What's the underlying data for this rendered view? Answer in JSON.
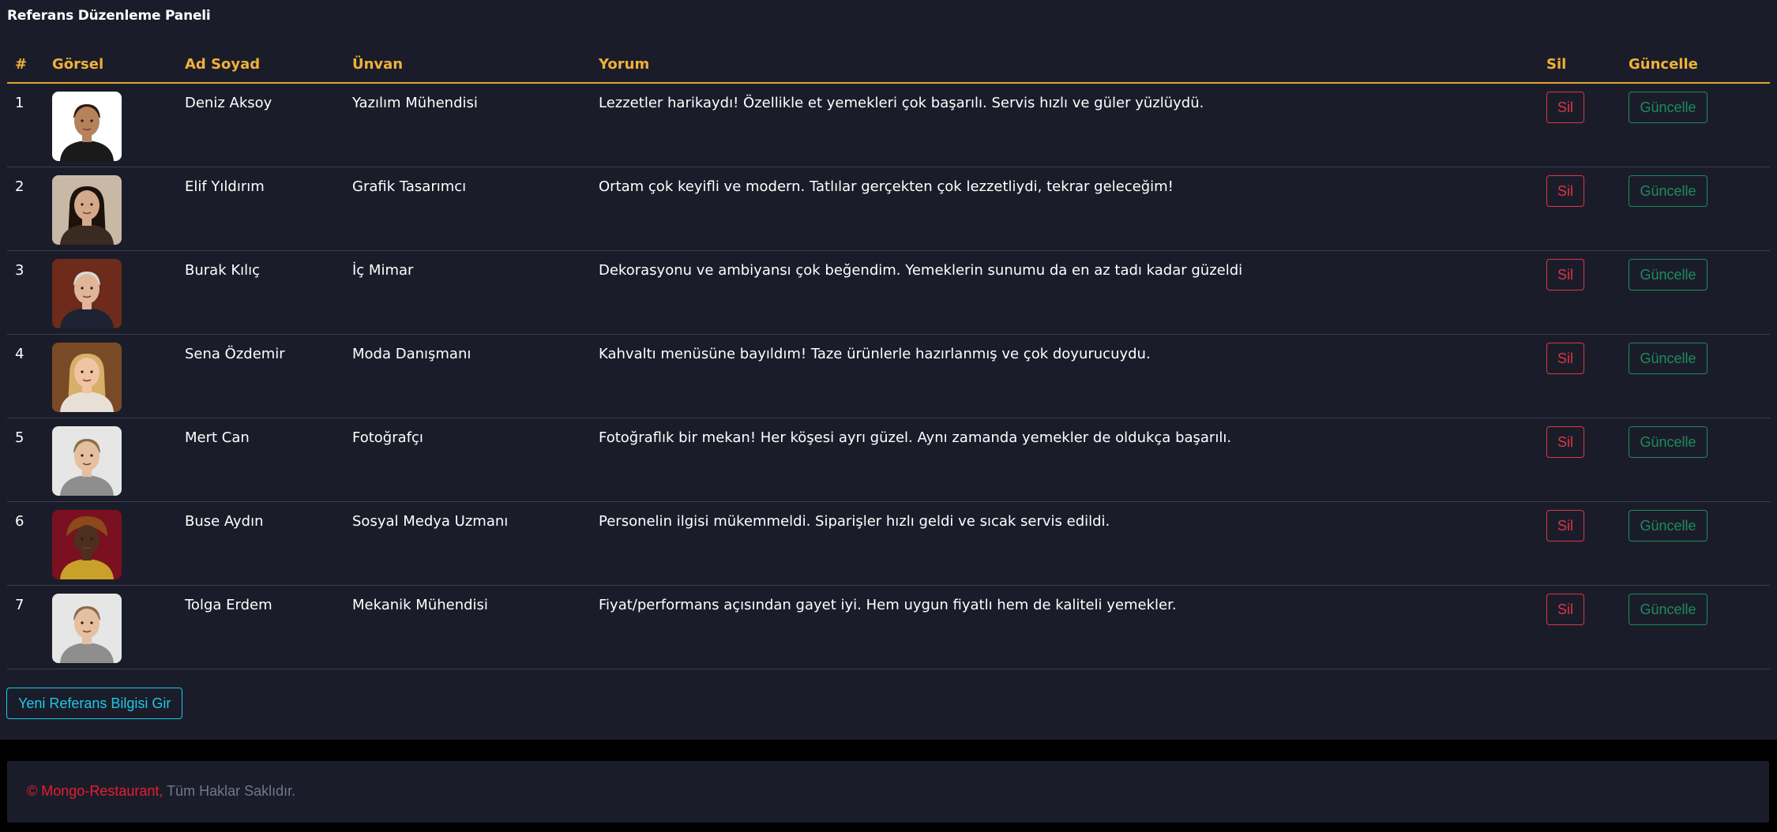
{
  "page": {
    "title": "Referans Düzenleme Paneli",
    "new_button": "Yeni Referans Bilgisi Gir"
  },
  "table": {
    "headers": [
      "#",
      "Görsel",
      "Ad Soyad",
      "Ünvan",
      "Yorum",
      "Sil",
      "Güncelle"
    ],
    "rows": [
      {
        "no": "1",
        "image": "portrait-man-bald",
        "name": "Deniz Aksoy",
        "title": "Yazılım Mühendisi",
        "comment": "Lezzetler harikaydı! Özellikle et yemekleri çok başarılı. Servis hızlı ve güler yüzlüydü.",
        "delete": "Sil",
        "update": "Güncelle"
      },
      {
        "no": "2",
        "image": "portrait-woman-dark-hair",
        "name": "Elif Yıldırım",
        "title": "Grafik Tasarımcı",
        "comment": "Ortam çok keyifli ve modern. Tatlılar gerçekten çok lezzetliydi, tekrar geleceğim!",
        "delete": "Sil",
        "update": "Güncelle"
      },
      {
        "no": "3",
        "image": "portrait-man-suit",
        "name": "Burak Kılıç",
        "title": "İç Mimar",
        "comment": "Dekorasyonu ve ambiyansı çok beğendim. Yemeklerin sunumu da en az tadı kadar güzeldi",
        "delete": "Sil",
        "update": "Güncelle"
      },
      {
        "no": "4",
        "image": "portrait-woman-blonde",
        "name": "Sena Özdemir",
        "title": "Moda Danışmanı",
        "comment": "Kahvaltı menüsüne bayıldım! Taze ürünlerle hazırlanmış ve çok doyurucuydu.",
        "delete": "Sil",
        "update": "Güncelle"
      },
      {
        "no": "5",
        "image": "portrait-man-glasses",
        "name": "Mert Can",
        "title": "Fotoğrafçı",
        "comment": "Fotoğraflık bir mekan! Her köşesi ayrı güzel. Aynı zamanda yemekler de oldukça başarılı.",
        "delete": "Sil",
        "update": "Güncelle"
      },
      {
        "no": "6",
        "image": "portrait-woman-headwrap",
        "name": "Buse Aydın",
        "title": "Sosyal Medya Uzmanı",
        "comment": "Personelin ilgisi mükemmeldi. Siparişler hızlı geldi ve sıcak servis edildi.",
        "delete": "Sil",
        "update": "Güncelle"
      },
      {
        "no": "7",
        "image": "portrait-man-glasses",
        "name": "Tolga Erdem",
        "title": "Mekanik Mühendisi",
        "comment": "Fiyat/performans açısından gayet iyi. Hem uygun fiyatlı hem de kaliteli yemekler.",
        "delete": "Sil",
        "update": "Güncelle"
      }
    ]
  },
  "footer": {
    "copyright": "©",
    "brand": "Mongo-Restaurant,",
    "rights": "Tüm Haklar Saklıdır."
  },
  "colors": {
    "background": "#1a1d29",
    "header": "#f0b03a",
    "delete": "#dc3545",
    "update": "#1f8a5c",
    "new": "#1ec7e6",
    "brand": "#e81d2f"
  }
}
